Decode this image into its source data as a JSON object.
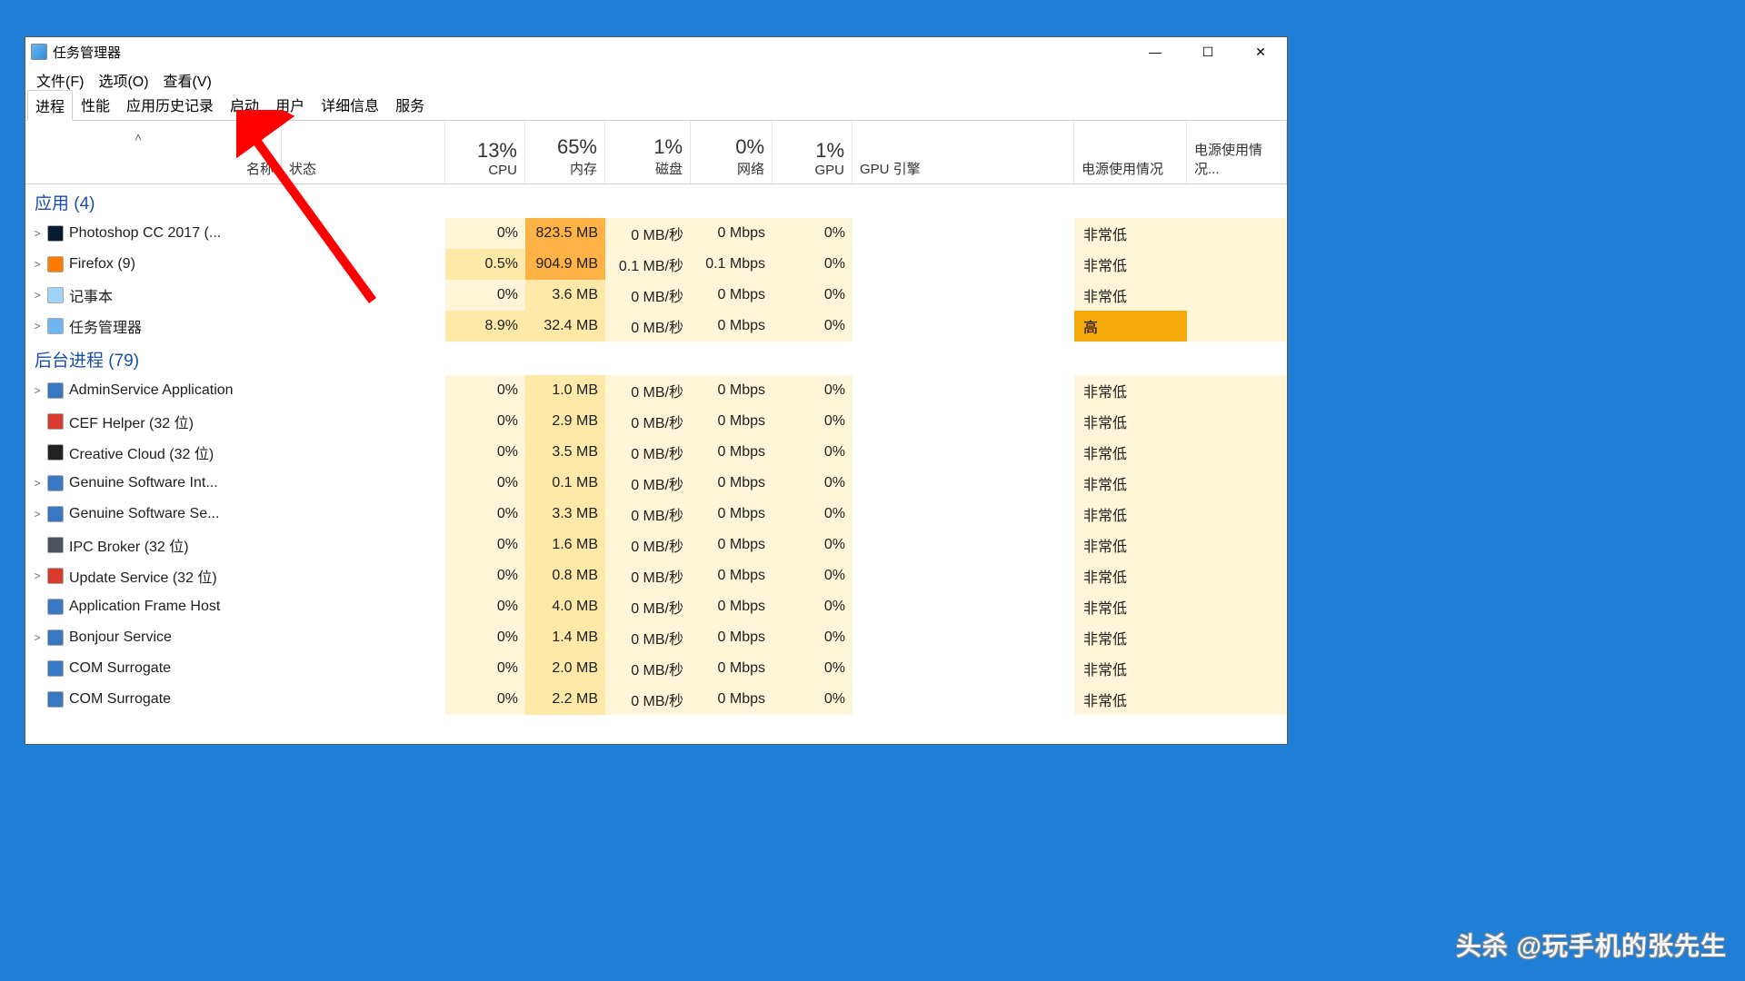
{
  "window": {
    "title": "任务管理器",
    "minimize": "—",
    "maximize": "☐",
    "close": "✕"
  },
  "menubar": [
    {
      "id": "file",
      "label": "文件(F)"
    },
    {
      "id": "options",
      "label": "选项(O)"
    },
    {
      "id": "view",
      "label": "查看(V)"
    }
  ],
  "tabs": [
    {
      "id": "processes",
      "label": "进程",
      "active": true
    },
    {
      "id": "performance",
      "label": "性能"
    },
    {
      "id": "app-history",
      "label": "应用历史记录"
    },
    {
      "id": "startup",
      "label": "启动"
    },
    {
      "id": "users",
      "label": "用户"
    },
    {
      "id": "details",
      "label": "详细信息"
    },
    {
      "id": "services",
      "label": "服务"
    }
  ],
  "columns": {
    "name": "名称",
    "status": "状态",
    "cpu": {
      "pct": "13%",
      "label": "CPU"
    },
    "memory": {
      "pct": "65%",
      "label": "内存"
    },
    "disk": {
      "pct": "1%",
      "label": "磁盘"
    },
    "network": {
      "pct": "0%",
      "label": "网络"
    },
    "gpu": {
      "pct": "1%",
      "label": "GPU"
    },
    "gpu_engine": "GPU 引擎",
    "power": "电源使用情况",
    "power_trend": "电源使用情况..."
  },
  "groups": [
    {
      "id": "apps",
      "title": "应用 (4)",
      "rows": [
        {
          "expand": true,
          "icon": "photoshop-icon",
          "iconBg": "#071c33",
          "name": "Photoshop CC 2017 (...",
          "cpu": "0%",
          "mem": "823.5 MB",
          "memShade": "shade3",
          "disk": "0 MB/秒",
          "net": "0 Mbps",
          "gpu": "0%",
          "power": "非常低",
          "powerShade": ""
        },
        {
          "expand": true,
          "icon": "firefox-icon",
          "iconBg": "#ff7b00",
          "name": "Firefox (9)",
          "cpu": "0.5%",
          "cpuShade": "shade2",
          "mem": "904.9 MB",
          "memShade": "shade3",
          "disk": "0.1 MB/秒",
          "net": "0.1 Mbps",
          "gpu": "0%",
          "power": "非常低",
          "powerShade": ""
        },
        {
          "expand": true,
          "icon": "notepad-icon",
          "iconBg": "#9fd4f5",
          "name": "记事本",
          "cpu": "0%",
          "mem": "3.6 MB",
          "disk": "0 MB/秒",
          "net": "0 Mbps",
          "gpu": "0%",
          "power": "非常低",
          "powerShade": ""
        },
        {
          "expand": true,
          "icon": "taskmgr-icon",
          "iconBg": "#6fb6f0",
          "name": "任务管理器",
          "cpu": "8.9%",
          "cpuShade": "shade2",
          "mem": "32.4 MB",
          "disk": "0 MB/秒",
          "net": "0 Mbps",
          "gpu": "0%",
          "power": "高",
          "powerShade": "shade5"
        }
      ]
    },
    {
      "id": "background",
      "title": "后台进程 (79)",
      "rows": [
        {
          "expand": true,
          "icon": "generic-icon",
          "iconBg": "#3b78c4",
          "name": "AdminService Application",
          "cpu": "0%",
          "mem": "1.0 MB",
          "disk": "0 MB/秒",
          "net": "0 Mbps",
          "gpu": "0%",
          "power": "非常低"
        },
        {
          "expand": false,
          "icon": "adobe-icon",
          "iconBg": "#d63b2b",
          "name": "CEF Helper (32 位)",
          "cpu": "0%",
          "mem": "2.9 MB",
          "disk": "0 MB/秒",
          "net": "0 Mbps",
          "gpu": "0%",
          "power": "非常低"
        },
        {
          "expand": false,
          "icon": "cc-icon",
          "iconBg": "#222",
          "name": "Creative Cloud (32 位)",
          "cpu": "0%",
          "mem": "3.5 MB",
          "disk": "0 MB/秒",
          "net": "0 Mbps",
          "gpu": "0%",
          "power": "非常低"
        },
        {
          "expand": true,
          "icon": "generic-icon",
          "iconBg": "#3b78c4",
          "name": "Genuine Software Int...",
          "cpu": "0%",
          "mem": "0.1 MB",
          "disk": "0 MB/秒",
          "net": "0 Mbps",
          "gpu": "0%",
          "power": "非常低"
        },
        {
          "expand": true,
          "icon": "generic-icon",
          "iconBg": "#3b78c4",
          "name": "Genuine Software Se...",
          "cpu": "0%",
          "mem": "3.3 MB",
          "disk": "0 MB/秒",
          "net": "0 Mbps",
          "gpu": "0%",
          "power": "非常低"
        },
        {
          "expand": false,
          "icon": "ipc-icon",
          "iconBg": "#4a5560",
          "name": "IPC Broker (32 位)",
          "cpu": "0%",
          "mem": "1.6 MB",
          "disk": "0 MB/秒",
          "net": "0 Mbps",
          "gpu": "0%",
          "power": "非常低"
        },
        {
          "expand": true,
          "icon": "adobe-icon",
          "iconBg": "#d63b2b",
          "name": "Update Service (32 位)",
          "cpu": "0%",
          "mem": "0.8 MB",
          "disk": "0 MB/秒",
          "net": "0 Mbps",
          "gpu": "0%",
          "power": "非常低"
        },
        {
          "expand": false,
          "icon": "generic-icon",
          "iconBg": "#3b78c4",
          "name": "Application Frame Host",
          "cpu": "0%",
          "mem": "4.0 MB",
          "disk": "0 MB/秒",
          "net": "0 Mbps",
          "gpu": "0%",
          "power": "非常低"
        },
        {
          "expand": true,
          "icon": "generic-icon",
          "iconBg": "#3b78c4",
          "name": "Bonjour Service",
          "cpu": "0%",
          "mem": "1.4 MB",
          "disk": "0 MB/秒",
          "net": "0 Mbps",
          "gpu": "0%",
          "power": "非常低"
        },
        {
          "expand": false,
          "icon": "generic-icon",
          "iconBg": "#3b78c4",
          "name": "COM Surrogate",
          "cpu": "0%",
          "mem": "2.0 MB",
          "disk": "0 MB/秒",
          "net": "0 Mbps",
          "gpu": "0%",
          "power": "非常低"
        },
        {
          "expand": false,
          "icon": "generic-icon",
          "iconBg": "#3b78c4",
          "name": "COM Surrogate",
          "cpu": "0%",
          "mem": "2.2 MB",
          "disk": "0 MB/秒",
          "net": "0 Mbps",
          "gpu": "0%",
          "power": "非常低"
        }
      ]
    }
  ],
  "watermark": "头杀 @玩手机的张先生"
}
